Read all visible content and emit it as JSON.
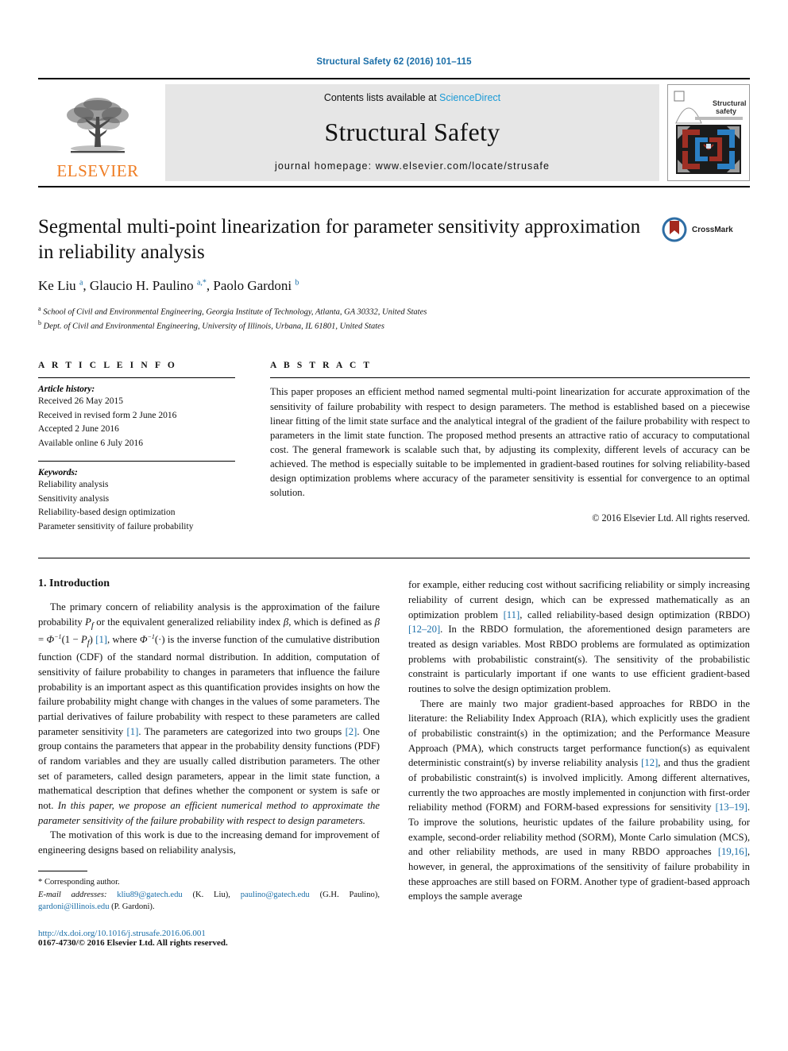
{
  "running_head": "Structural Safety 62 (2016) 101–115",
  "masthead": {
    "publisher_name": "ELSEVIER",
    "contents_prefix": "Contents lists available at ",
    "sciencedirect": "ScienceDirect",
    "journal_name": "Structural Safety",
    "homepage": "journal homepage: www.elsevier.com/locate/strusafe",
    "cover_title_line1": "Structural",
    "cover_title_line2": "safety"
  },
  "article": {
    "title": "Segmental multi-point linearization for parameter sensitivity approximation in reliability analysis",
    "authors_html": "Ke Liu <sup>a</sup>, Glaucio H. Paulino <sup>a,*</sup>, Paolo Gardoni <sup>b</sup>",
    "affiliation_a": "School of Civil and Environmental Engineering, Georgia Institute of Technology, Atlanta, GA 30332, United States",
    "affiliation_b": "Dept. of Civil and Environmental Engineering, University of Illinois, Urbana, IL 61801, United States",
    "crossmark_label": "CrossMark"
  },
  "article_info": {
    "heading": "A R T I C L E   I N F O",
    "history_label": "Article history:",
    "history": [
      "Received 26 May 2015",
      "Received in revised form 2 June 2016",
      "Accepted 2 June 2016",
      "Available online 6 July 2016"
    ],
    "keywords_label": "Keywords:",
    "keywords": [
      "Reliability analysis",
      "Sensitivity analysis",
      "Reliability-based design optimization",
      "Parameter sensitivity of failure probability"
    ]
  },
  "abstract": {
    "heading": "A B S T R A C T",
    "text": "This paper proposes an efficient method named segmental multi-point linearization for accurate approximation of the sensitivity of failure probability with respect to design parameters. The method is established based on a piecewise linear fitting of the limit state surface and the analytical integral of the gradient of the failure probability with respect to parameters in the limit state function. The proposed method presents an attractive ratio of accuracy to computational cost. The general framework is scalable such that, by adjusting its complexity, different levels of accuracy can be achieved. The method is especially suitable to be implemented in gradient-based routines for solving reliability-based design optimization problems where accuracy of the parameter sensitivity is essential for convergence to an optimal solution.",
    "copyright": "© 2016 Elsevier Ltd. All rights reserved."
  },
  "body": {
    "section_number_title": "1. Introduction",
    "left_paragraphs": [
      "The primary concern of reliability analysis is the approximation of the failure probability Pf or the equivalent generalized reliability index β, which is defined as β = Φ−1(1 − Pf) [1], where Φ−1(·) is the inverse function of the cumulative distribution function (CDF) of the standard normal distribution. In addition, computation of sensitivity of failure probability to changes in parameters that influence the failure probability is an important aspect as this quantification provides insights on how the failure probability might change with changes in the values of some parameters. The partial derivatives of failure probability with respect to these parameters are called parameter sensitivity [1]. The parameters are categorized into two groups [2]. One group contains the parameters that appear in the probability density functions (PDF) of random variables and they are usually called distribution parameters. The other set of parameters, called design parameters, appear in the limit state function, a mathematical description that defines whether the component or system is safe or not. In this paper, we propose an efficient numerical method to approximate the parameter sensitivity of the failure probability with respect to design parameters.",
      "The motivation of this work is due to the increasing demand for improvement of engineering designs based on reliability analysis,"
    ],
    "right_paragraphs": [
      "for example, either reducing cost without sacrificing reliability or simply increasing reliability of current design, which can be expressed mathematically as an optimization problem [11], called reliability-based design optimization (RBDO) [12–20]. In the RBDO formulation, the aforementioned design parameters are treated as design variables. Most RBDO problems are formulated as optimization problems with probabilistic constraint(s). The sensitivity of the probabilistic constraint is particularly important if one wants to use efficient gradient-based routines to solve the design optimization problem.",
      "There are mainly two major gradient-based approaches for RBDO in the literature: the Reliability Index Approach (RIA), which explicitly uses the gradient of probabilistic constraint(s) in the optimization; and the Performance Measure Approach (PMA), which constructs target performance function(s) as equivalent deterministic constraint(s) by inverse reliability analysis [12], and thus the gradient of probabilistic constraint(s) is involved implicitly. Among different alternatives, currently the two approaches are mostly implemented in conjunction with first-order reliability method (FORM) and FORM-based expressions for sensitivity [13–19]. To improve the solutions, heuristic updates of the failure probability using, for example, second-order reliability method (SORM), Monte Carlo simulation (MCS), and other reliability methods, are used in many RBDO approaches [19,16], however, in general, the approximations of the sensitivity of failure probability in these approaches are still based on FORM. Another type of gradient-based approach employs the sample average"
    ]
  },
  "footnote": {
    "corresponding": "* Corresponding author.",
    "email_label": "E-mail addresses:",
    "emails": [
      {
        "address": "kliu89@gatech.edu",
        "owner": "(K. Liu)"
      },
      {
        "address": "paulino@gatech.edu",
        "owner": "(G.H. Paulino)"
      },
      {
        "address": "gardoni@illinois.edu",
        "owner": "(P. Gardoni)"
      }
    ]
  },
  "footer": {
    "doi": "http://dx.doi.org/10.1016/j.strusafe.2016.06.001",
    "issn_line": "0167-4730/© 2016 Elsevier Ltd. All rights reserved."
  },
  "colors": {
    "link_blue": "#1a6ea8",
    "sciencedirect_blue": "#1a9ad6",
    "elsevier_orange": "#ef7c22",
    "masthead_grey": "#e6e6e6"
  }
}
